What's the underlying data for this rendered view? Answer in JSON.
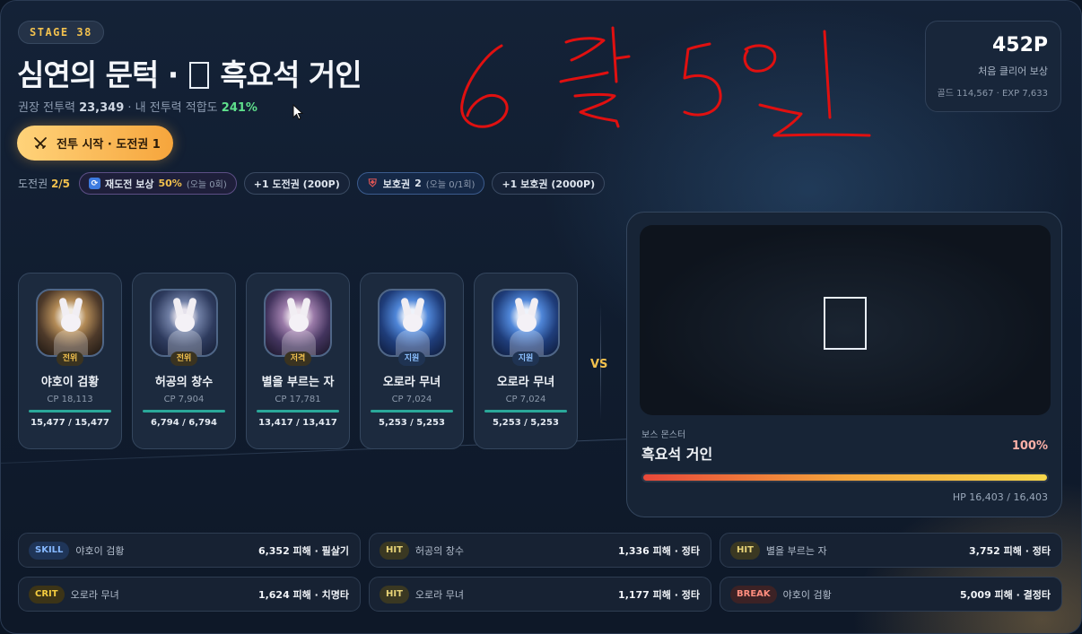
{
  "stage": {
    "badge": "STAGE 38"
  },
  "title": {
    "prefix": "심연의 문턱 · ",
    "boss_name": "흑요석 거인"
  },
  "subline": {
    "rec_label": "권장 전투력",
    "rec_value": "23,349",
    "sep": " · ",
    "fit_label": "내 전투력 적합도",
    "fit_value": "241%"
  },
  "start_button": {
    "label": "전투 시작 · 도전권 1"
  },
  "tickets": {
    "label": "도전권",
    "count": "2/5",
    "retry": {
      "label": "재도전 보상",
      "value": "50%",
      "note": "(오늘 0회)"
    },
    "buy_ticket": "+1 도전권 (200P)",
    "shield": {
      "label": "보호권",
      "value": "2",
      "note": "(오늘 0/1회)"
    },
    "buy_shield": "+1 보호권 (2000P)"
  },
  "handwriting": {
    "text": "6월5일",
    "color": "#e01010"
  },
  "reward": {
    "points": "452P",
    "caption": "처음 클리어 보상",
    "detail": "골드 114,567 · EXP 7,633"
  },
  "party": [
    {
      "role": "전위",
      "name": "야호이 검황",
      "cp": "CP 18,113",
      "hp": "15,477 / 15,477",
      "hp_ratio": 1.0,
      "theme": "gold"
    },
    {
      "role": "전위",
      "name": "허공의 창수",
      "cp": "CP 7,904",
      "hp": "6,794 / 6,794",
      "hp_ratio": 1.0,
      "theme": "default"
    },
    {
      "role": "저격",
      "name": "별을 부르는 자",
      "cp": "CP 17,781",
      "hp": "13,417 / 13,417",
      "hp_ratio": 1.0,
      "theme": "purple"
    },
    {
      "role": "지원",
      "name": "오로라 무녀",
      "cp": "CP 7,024",
      "hp": "5,253 / 5,253",
      "hp_ratio": 1.0,
      "theme": "blue"
    },
    {
      "role": "지원",
      "name": "오로라 무녀",
      "cp": "CP 7,024",
      "hp": "5,253 / 5,253",
      "hp_ratio": 1.0,
      "theme": "blue"
    }
  ],
  "vs": "VS",
  "boss": {
    "label": "보스 몬스터",
    "name": "흑요석 거인",
    "percent": "100%",
    "hp_ratio": 1.0,
    "hp": "HP 16,403 / 16,403"
  },
  "log": [
    {
      "tag": "SKILL",
      "kind": "skill",
      "who": "야호이 검황",
      "dmg": "6,352 피해 · 필살기"
    },
    {
      "tag": "HIT",
      "kind": "hit",
      "who": "허공의 창수",
      "dmg": "1,336 피해 · 정타"
    },
    {
      "tag": "HIT",
      "kind": "hit",
      "who": "별을 부르는 자",
      "dmg": "3,752 피해 · 정타"
    },
    {
      "tag": "CRIT",
      "kind": "crit",
      "who": "오로라 무녀",
      "dmg": "1,624 피해 · 치명타"
    },
    {
      "tag": "HIT",
      "kind": "hit",
      "who": "오로라 무녀",
      "dmg": "1,177 피해 · 정타"
    },
    {
      "tag": "BREAK",
      "kind": "break",
      "who": "야호이 검황",
      "dmg": "5,009 피해 · 결정타"
    }
  ],
  "colors": {
    "gold": "#f2c14e",
    "green": "#5fe08c",
    "teal": "#2aa89a",
    "boss_red": "#e8483a"
  },
  "icons": {
    "start": "crossed-swords-icon",
    "retry": "refresh-icon",
    "shield": "shield-icon",
    "cursor": "mouse-cursor-icon"
  }
}
